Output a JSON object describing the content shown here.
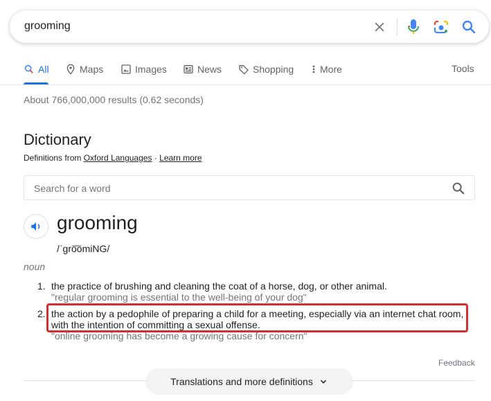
{
  "search": {
    "query": "grooming"
  },
  "tabs": [
    {
      "label": "All",
      "icon": "search-icon",
      "active": true
    },
    {
      "label": "Maps",
      "icon": "map-pin-icon"
    },
    {
      "label": "Images",
      "icon": "image-icon"
    },
    {
      "label": "News",
      "icon": "news-icon"
    },
    {
      "label": "Shopping",
      "icon": "tag-icon"
    },
    {
      "label": "More",
      "icon": "more-vert-icon"
    }
  ],
  "tools_label": "Tools",
  "result_stats": "About 766,000,000 results (0.62 seconds)",
  "dictionary": {
    "title": "Dictionary",
    "source_prefix": "Definitions from",
    "source_name": "Oxford Languages",
    "separator": "·",
    "learn_more": "Learn more",
    "search_placeholder": "Search for a word",
    "word": "grooming",
    "pronunciation": "/ˈɡro͞omiNG/",
    "part_of_speech": "noun",
    "definitions": [
      {
        "number": "1.",
        "text": "the practice of brushing and cleaning the coat of a horse, dog, or other animal.",
        "example": "\"regular grooming is essential to the well-being of your dog\""
      },
      {
        "number": "2.",
        "text_line1": "the action by a pedophile of preparing a child for a meeting, especially via an internet chat room,",
        "text_line2": "with the intention of committing a sexual offense.",
        "example": "\"online grooming has become a growing cause for concern\""
      }
    ],
    "feedback": "Feedback",
    "more_button": "Translations and more definitions"
  },
  "colors": {
    "accent": "#1a73e8",
    "highlight": "#d32f2f",
    "muted": "#70757a"
  }
}
